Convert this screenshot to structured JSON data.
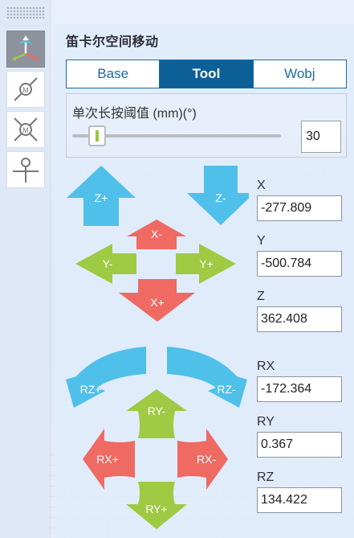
{
  "panel": {
    "title": "笛卡尔空间移动"
  },
  "frame_tabs": [
    {
      "label": "Base",
      "active": false
    },
    {
      "label": "Tool",
      "active": true
    },
    {
      "label": "Wobj",
      "active": false
    }
  ],
  "step": {
    "label": "单次长按阈值 (mm)(°)",
    "value": "30"
  },
  "jog": {
    "z_plus": "Z+",
    "z_minus": "Z-",
    "x_minus": "X-",
    "x_plus": "X+",
    "y_minus": "Y-",
    "y_plus": "Y+",
    "rz_plus": "RZ+",
    "rz_minus": "RZ-",
    "ry_minus": "RY-",
    "ry_plus": "RY+",
    "rx_plus": "RX+",
    "rx_minus": "RX-"
  },
  "coords": {
    "x": {
      "label": "X",
      "value": "-277.809"
    },
    "y": {
      "label": "Y",
      "value": "-500.784"
    },
    "z": {
      "label": "Z",
      "value": "362.408"
    },
    "rx": {
      "label": "RX",
      "value": "-172.364"
    },
    "ry": {
      "label": "RY",
      "value": "0.367"
    },
    "rz": {
      "label": "RZ",
      "value": "134.422"
    }
  },
  "colors": {
    "blue": "#4fc0ea",
    "red": "#ee6a63",
    "green": "#9fca43",
    "accent": "#0d5f98"
  },
  "sidebar_icons": [
    "cartesian-axes-icon",
    "linear-move-icon",
    "multi-point-move-icon",
    "waypoint-icon"
  ]
}
